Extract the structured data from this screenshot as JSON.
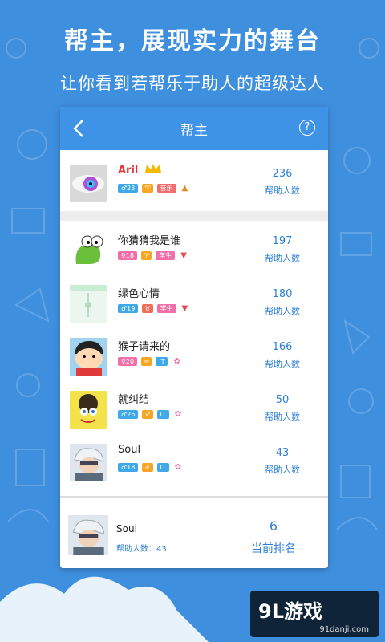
{
  "promo": {
    "headline": "帮主，展现实力的舞台",
    "subline": "让你看到若帮乐于助人的超级达人"
  },
  "appbar": {
    "title": "帮主",
    "help_glyph": "?"
  },
  "top_user": {
    "name": "Aril",
    "age": "♂23",
    "zodiac": "♈",
    "category": "音乐",
    "count": "236",
    "count_label": "帮助人数"
  },
  "list": [
    {
      "name": "你猜猜我是谁",
      "age": "♀18",
      "zodiac": "♈",
      "category": "学生",
      "count": "197",
      "count_label": "帮助人数"
    },
    {
      "name": "绿色心情",
      "age": "♂19",
      "zodiac": "♉",
      "category": "学生",
      "count": "180",
      "count_label": "帮助人数"
    },
    {
      "name": "猴子请来的",
      "age": "♀20",
      "zodiac": "♒",
      "category": "IT",
      "count": "166",
      "count_label": "帮助人数"
    },
    {
      "name": "就纠结",
      "age": "♂26",
      "zodiac": "♐",
      "category": "IT",
      "count": "50",
      "count_label": "帮助人数"
    },
    {
      "name": "Soul",
      "age": "♂18",
      "zodiac": "♌",
      "category": "IT",
      "count": "43",
      "count_label": "帮助人数"
    }
  ],
  "me": {
    "name": "Soul",
    "help_count_text": "帮助人数：43",
    "rank": "6",
    "rank_label": "当前排名"
  },
  "watermark": {
    "brand": "9L游戏",
    "site": "91danji.com"
  },
  "colors": {
    "background": "#3f8fdf",
    "appbar": "#3f93e6",
    "accent": "#2d7fd6"
  }
}
